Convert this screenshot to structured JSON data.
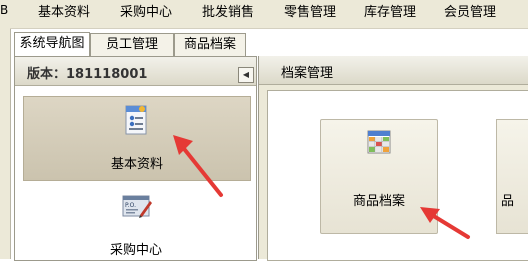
{
  "window": {
    "edge_char": "B"
  },
  "menubar": {
    "items": [
      {
        "label": "基本资料"
      },
      {
        "label": "采购中心"
      },
      {
        "label": "批发销售"
      },
      {
        "label": "零售管理"
      },
      {
        "label": "库存管理"
      },
      {
        "label": "会员管理"
      }
    ]
  },
  "tabs": [
    {
      "label": "系统导航图",
      "active": true
    },
    {
      "label": "员工管理",
      "active": false
    },
    {
      "label": "商品档案",
      "active": false
    }
  ],
  "left_panel": {
    "version_label": "版本：181118001",
    "collapse_icon": "left-triangle",
    "nav_items": [
      {
        "label": "基本资料",
        "icon": "document-icon",
        "selected": true
      },
      {
        "label": "采购中心",
        "icon": "purchase-order-icon",
        "selected": false
      }
    ]
  },
  "right_panel": {
    "title": "档案管理",
    "buttons": [
      {
        "label": "商品档案",
        "icon": "grid-table-icon"
      },
      {
        "label": "品"
      }
    ]
  },
  "annotations": {
    "arrow_color": "#e53935"
  }
}
